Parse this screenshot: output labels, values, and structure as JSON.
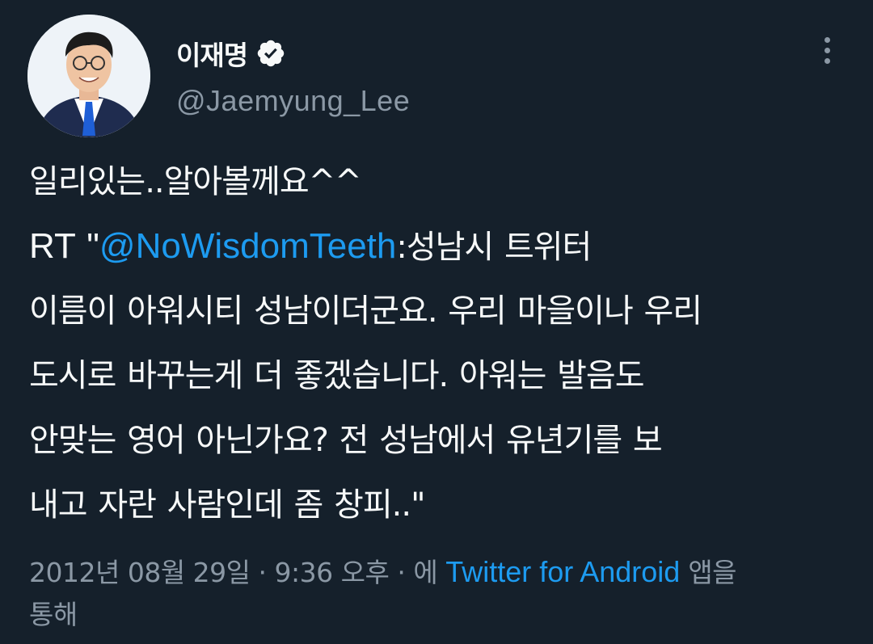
{
  "author": {
    "display_name": "이재명",
    "handle": "@Jaemyung_Lee",
    "verified_icon": "verified-badge-icon",
    "avatar": "profile-photo"
  },
  "menu": {
    "icon": "more-vertical-icon"
  },
  "tweet": {
    "line1": "일리있는..알아볼께요^^",
    "rt_prefix": "RT \"",
    "mention": "@NoWisdomTeeth",
    "line2_rest": ":성남시 트위터",
    "line3": "이름이 아워시티 성남이더군요. 우리 마을이나 우리",
    "line4": "도시로 바꾸는게 더 좋겠습니다. 아워는 발음도",
    "line5": "안맞는 영어 아닌가요? 전 성남에서 유년기를 보",
    "line6": "내고 자란 사람인데 좀 창피..\""
  },
  "meta": {
    "date": "2012년 08월 29일",
    "sep1": " · ",
    "time": "9:36 오후",
    "sep2": " · ",
    "via_prefix": "에 ",
    "source": "Twitter for Android",
    "via_suffix": " 앱을",
    "via_suffix2": "통해"
  },
  "colors": {
    "background": "#15202b",
    "text": "#f7f9f9",
    "secondary": "#8b98a5",
    "link": "#1d9bf0"
  }
}
